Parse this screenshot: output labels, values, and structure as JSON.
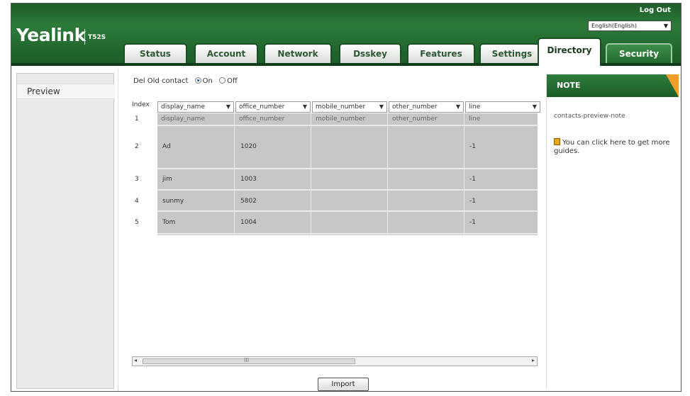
{
  "header": {
    "logo": "Yealink",
    "model": "T52S",
    "logout": "Log Out",
    "language": "English(English)"
  },
  "tabs": [
    "Status",
    "Account",
    "Network",
    "Dsskey",
    "Features",
    "Settings",
    "Directory",
    "Security"
  ],
  "leftnav": {
    "items": [
      "Preview"
    ]
  },
  "main": {
    "del_old_label": "Del Old contact",
    "on_label": "On",
    "off_label": "Off",
    "index_label": "Index",
    "columns": [
      "display_name",
      "office_number",
      "mobile_number",
      "other_number",
      "line"
    ],
    "rows": [
      {
        "index": "1",
        "display_name": "display_name",
        "office_number": "office_number",
        "mobile_number": "mobile_number",
        "other_number": "other_number",
        "line": "line"
      },
      {
        "index": "2",
        "display_name": "Ad",
        "office_number": "1020",
        "mobile_number": "",
        "other_number": "",
        "line": "-1"
      },
      {
        "index": "3",
        "display_name": "jim",
        "office_number": "1003",
        "mobile_number": "",
        "other_number": "",
        "line": "-1"
      },
      {
        "index": "4",
        "display_name": "sunmy",
        "office_number": "5802",
        "mobile_number": "",
        "other_number": "",
        "line": "-1"
      },
      {
        "index": "5",
        "display_name": "Tom",
        "office_number": "1004",
        "mobile_number": "",
        "other_number": "",
        "line": "-1"
      }
    ],
    "scroll_mark": "III",
    "import_button": "Import"
  },
  "note": {
    "title": "NOTE",
    "text": "contacts-preview-note",
    "guide": "You can click here to get more guides."
  }
}
